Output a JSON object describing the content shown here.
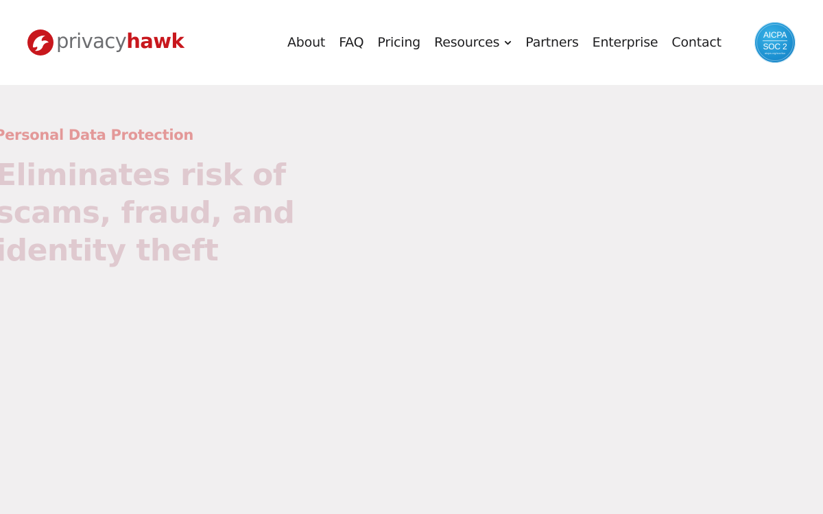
{
  "brand": {
    "name_part1": "privacy",
    "name_part2": "hawk",
    "icon": "hawk-logo-icon",
    "colors": {
      "gray": "#6d6e71",
      "red": "#c8171d"
    }
  },
  "nav": {
    "items": [
      {
        "label": "About"
      },
      {
        "label": "FAQ"
      },
      {
        "label": "Pricing"
      },
      {
        "label": "Resources",
        "icon": "chevron-down-icon"
      },
      {
        "label": "Partners"
      },
      {
        "label": "Enterprise"
      },
      {
        "label": "Contact"
      }
    ]
  },
  "badge": {
    "line1": "AICPA",
    "line2": "SOC 2",
    "line3": "aicpa.org/soc4so",
    "color": "#1b8fd0"
  },
  "hero": {
    "eyebrow": "Personal Data Protection",
    "headline_lines": [
      "Eliminates risk of",
      "scams, fraud, and",
      "identity theft"
    ],
    "colors": {
      "background": "#f1eff0",
      "eyebrow": "#e39898",
      "headline": "#dfc9cf"
    }
  }
}
